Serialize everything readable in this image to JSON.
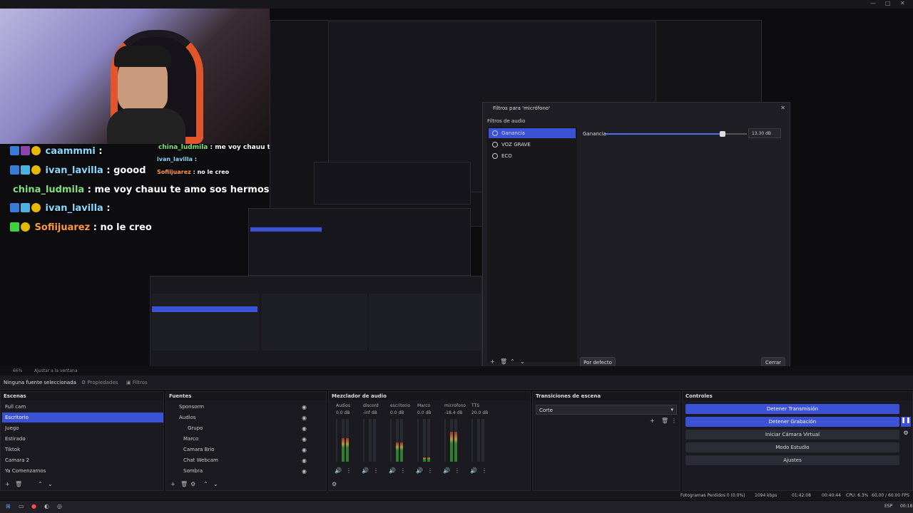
{
  "window": {
    "title": "",
    "controls": [
      "—",
      "□",
      "✕"
    ]
  },
  "chat": [
    {
      "user": "caammmi",
      "msg": ":",
      "color": "#8ad7ff"
    },
    {
      "user": "ivan_lavilla",
      "msg": ": goood",
      "color": "#8ad7ff"
    },
    {
      "user": "china_ludmila",
      "msg": ": me voy chauu te amo sos hermosa",
      "color": "#7ee37a"
    },
    {
      "user": "ivan_lavilla",
      "msg": ":",
      "color": "#8ad7ff"
    },
    {
      "user": "Sofiijuarez",
      "msg": ": no le creo",
      "color": "#ff9a3d"
    }
  ],
  "chat_small": [
    {
      "user": "china_ludmila",
      "msg": ": me voy chauu te amo sos hermosa"
    },
    {
      "user": "ivan_lavilla",
      "msg": ":"
    },
    {
      "user": "Sofiijuarez",
      "msg": ": no le creo"
    }
  ],
  "filters_dialog": {
    "title": "Filtros para 'micrófono'",
    "section": "Filtros de audio",
    "items": [
      "Ganancia",
      "VOZ GRAVE",
      "ECO"
    ],
    "selected": "Ganancia",
    "gain_label": "Ganancia",
    "gain_value": "13.30 dB",
    "gain_level": 0.92,
    "default_btn": "Por defecto",
    "close_btn": "Cerrar"
  },
  "preview_status": {
    "zoom": "66%",
    "fit": "Ajustar a la ventana"
  },
  "propbar": {
    "none_selected": "Ninguna fuente seleccionada",
    "properties": "Propiedades",
    "filters": "Filtros"
  },
  "scenes": {
    "title": "Escenas",
    "items": [
      "Full cam",
      "Escritorio",
      "Juego",
      "Estirado",
      "Tiktok",
      "Camara 2",
      "Ya Comenzamos"
    ],
    "selected": "Escritorio"
  },
  "sources": {
    "title": "Fuentes",
    "items": [
      "Sponsorm",
      "Audios",
      "Grupo",
      "Marco",
      "Camara Brio",
      "Chat Webcam",
      "Sombra"
    ]
  },
  "mixer": {
    "title": "Mezclador de audio",
    "channels": [
      {
        "name": "Audios",
        "db": "0.0 dB",
        "level": 0.55
      },
      {
        "name": "discord",
        "db": "-inf dB",
        "level": 0.0
      },
      {
        "name": "escritorio",
        "db": "0.0 dB",
        "level": 0.45
      },
      {
        "name": "Marco",
        "db": "0.0 dB",
        "level": 0.1
      },
      {
        "name": "microfono",
        "db": "-18.4 dB",
        "level": 0.7
      },
      {
        "name": "TTS",
        "db": "20.0 dB",
        "level": 0.0
      }
    ]
  },
  "transitions": {
    "title": "Transiciones de escena",
    "selected": "Corte"
  },
  "controls": {
    "title": "Controles",
    "buttons": [
      "Detener Transmisión",
      "Detener Grabación",
      "Iniciar Cámara Virtual",
      "Modo Estudio",
      "Ajustes"
    ]
  },
  "statusbar": {
    "dropped": "Fotogramas Perdidos 0 (0.0%)",
    "kbps": "1094 kbps",
    "stream_time": "01:42:08",
    "rec_time": "00:40:44",
    "cpu": "CPU: 6.3%",
    "fps": "60.00 / 60.00 FPS"
  },
  "taskbar": {
    "lang": "ESP",
    "time": "00:18"
  }
}
